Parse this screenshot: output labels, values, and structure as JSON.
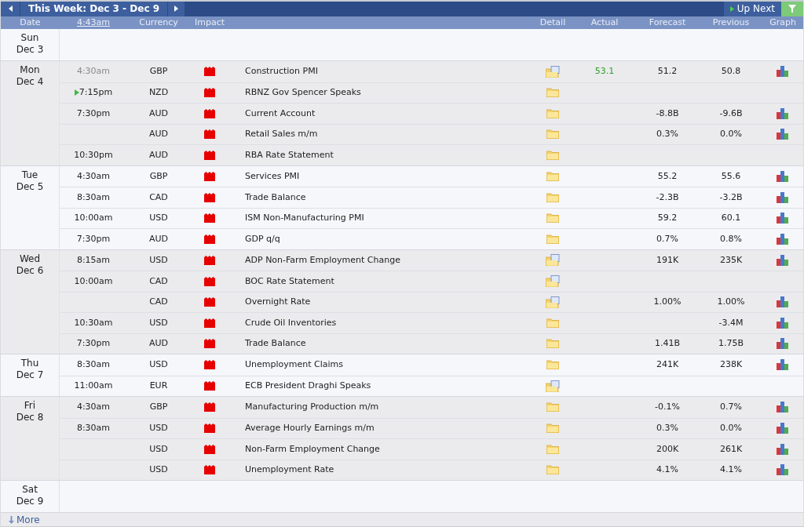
{
  "toolbar": {
    "week_label": "This Week: Dec 3 - Dec 9",
    "up_next": "Up Next"
  },
  "columns": {
    "date": "Date",
    "time": "4:43am",
    "currency": "Currency",
    "impact": "Impact",
    "detail": "Detail",
    "actual": "Actual",
    "forecast": "Forecast",
    "previous": "Previous",
    "graph": "Graph"
  },
  "days": [
    {
      "day": "Sun",
      "date": "Dec 3"
    },
    {
      "day": "Mon",
      "date": "Dec 4",
      "events": [
        {
          "time": "4:30am",
          "past": true,
          "up_next": false,
          "currency": "GBP",
          "high_impact": true,
          "title": "Construction PMI",
          "detail_document": true,
          "actual": "53.1",
          "actual_better": true,
          "forecast": "51.2",
          "previous": "50.8",
          "graph": true
        },
        {
          "time": "7:15pm",
          "past": false,
          "up_next": true,
          "currency": "NZD",
          "high_impact": true,
          "title": "RBNZ Gov Spencer Speaks",
          "detail_document": false,
          "graph": false
        },
        {
          "time": "7:30pm",
          "past": false,
          "up_next": false,
          "currency": "AUD",
          "high_impact": true,
          "title": "Current Account",
          "detail_document": false,
          "forecast": "-8.8B",
          "previous": "-9.6B",
          "graph": true
        },
        {
          "up_next": false,
          "currency": "AUD",
          "high_impact": true,
          "title": "Retail Sales m/m",
          "detail_document": false,
          "forecast": "0.3%",
          "previous": "0.0%",
          "graph": true
        },
        {
          "time": "10:30pm",
          "past": false,
          "up_next": false,
          "currency": "AUD",
          "high_impact": true,
          "title": "RBA Rate Statement",
          "detail_document": false,
          "graph": false
        }
      ]
    },
    {
      "day": "Tue",
      "date": "Dec 5",
      "events": [
        {
          "time": "4:30am",
          "past": false,
          "up_next": false,
          "currency": "GBP",
          "high_impact": true,
          "title": "Services PMI",
          "detail_document": false,
          "forecast": "55.2",
          "previous": "55.6",
          "graph": true
        },
        {
          "time": "8:30am",
          "past": false,
          "up_next": false,
          "currency": "CAD",
          "high_impact": true,
          "title": "Trade Balance",
          "detail_document": false,
          "forecast": "-2.3B",
          "previous": "-3.2B",
          "graph": true
        },
        {
          "time": "10:00am",
          "past": false,
          "up_next": false,
          "currency": "USD",
          "high_impact": true,
          "title": "ISM Non-Manufacturing PMI",
          "detail_document": false,
          "forecast": "59.2",
          "previous": "60.1",
          "graph": true
        },
        {
          "time": "7:30pm",
          "past": false,
          "up_next": false,
          "currency": "AUD",
          "high_impact": true,
          "title": "GDP q/q",
          "detail_document": false,
          "forecast": "0.7%",
          "previous": "0.8%",
          "graph": true
        }
      ]
    },
    {
      "day": "Wed",
      "date": "Dec 6",
      "events": [
        {
          "time": "8:15am",
          "past": false,
          "up_next": false,
          "currency": "USD",
          "high_impact": true,
          "title": "ADP Non-Farm Employment Change",
          "detail_document": true,
          "forecast": "191K",
          "previous": "235K",
          "graph": true
        },
        {
          "time": "10:00am",
          "past": false,
          "up_next": false,
          "currency": "CAD",
          "high_impact": true,
          "title": "BOC Rate Statement",
          "detail_document": true,
          "graph": false
        },
        {
          "up_next": false,
          "currency": "CAD",
          "high_impact": true,
          "title": "Overnight Rate",
          "detail_document": true,
          "forecast": "1.00%",
          "previous": "1.00%",
          "graph": true
        },
        {
          "time": "10:30am",
          "past": false,
          "up_next": false,
          "currency": "USD",
          "high_impact": true,
          "title": "Crude Oil Inventories",
          "detail_document": false,
          "previous": "-3.4M",
          "graph": true
        },
        {
          "time": "7:30pm",
          "past": false,
          "up_next": false,
          "currency": "AUD",
          "high_impact": true,
          "title": "Trade Balance",
          "detail_document": false,
          "forecast": "1.41B",
          "previous": "1.75B",
          "graph": true
        }
      ]
    },
    {
      "day": "Thu",
      "date": "Dec 7",
      "events": [
        {
          "time": "8:30am",
          "past": false,
          "up_next": false,
          "currency": "USD",
          "high_impact": true,
          "title": "Unemployment Claims",
          "detail_document": false,
          "forecast": "241K",
          "previous": "238K",
          "graph": true
        },
        {
          "time": "11:00am",
          "past": false,
          "up_next": false,
          "currency": "EUR",
          "high_impact": true,
          "title": "ECB President Draghi Speaks",
          "detail_document": true,
          "graph": false
        }
      ]
    },
    {
      "day": "Fri",
      "date": "Dec 8",
      "events": [
        {
          "time": "4:30am",
          "past": false,
          "up_next": false,
          "currency": "GBP",
          "high_impact": true,
          "title": "Manufacturing Production m/m",
          "detail_document": false,
          "forecast": "-0.1%",
          "previous": "0.7%",
          "graph": true
        },
        {
          "time": "8:30am",
          "past": false,
          "up_next": false,
          "currency": "USD",
          "high_impact": true,
          "title": "Average Hourly Earnings m/m",
          "detail_document": false,
          "forecast": "0.3%",
          "previous": "0.0%",
          "graph": true
        },
        {
          "up_next": false,
          "currency": "USD",
          "high_impact": true,
          "title": "Non-Farm Employment Change",
          "detail_document": false,
          "forecast": "200K",
          "previous": "261K",
          "graph": true
        },
        {
          "up_next": false,
          "currency": "USD",
          "high_impact": true,
          "title": "Unemployment Rate",
          "detail_document": false,
          "forecast": "4.1%",
          "previous": "4.1%",
          "graph": true
        }
      ]
    },
    {
      "day": "Sat",
      "date": "Dec 9"
    }
  ],
  "more": "More"
}
